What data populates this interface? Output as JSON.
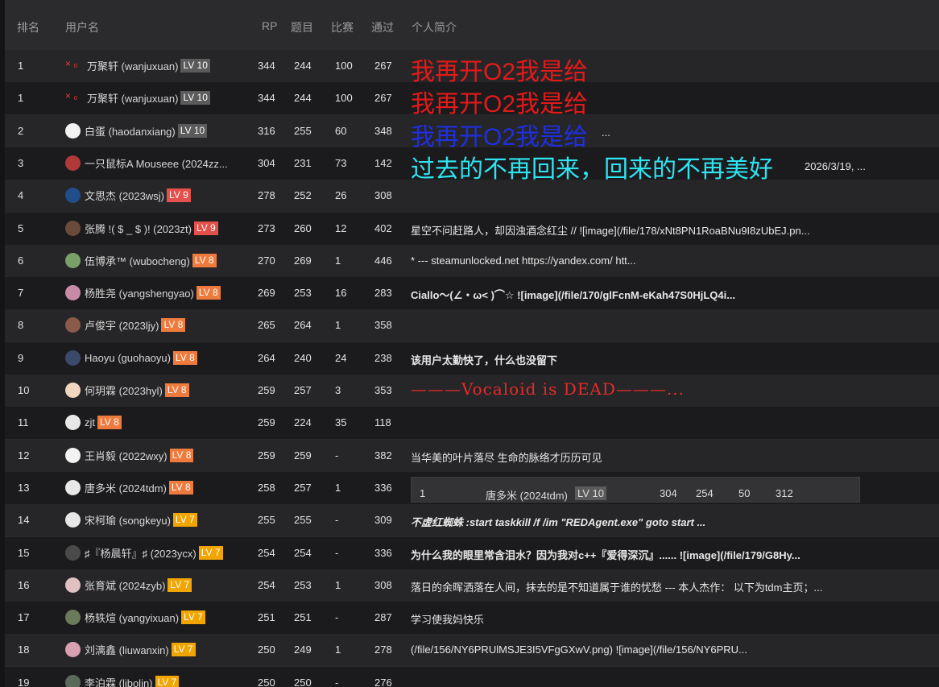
{
  "header": {
    "rank": "排名",
    "username": "用户名",
    "rp": "RP",
    "problems": "题目",
    "contests": "比赛",
    "passed": "通过",
    "intro": "个人简介"
  },
  "rows": [
    {
      "rank": "1",
      "name": "万聚轩 (wanjuxuan)",
      "lv": "LV 10",
      "rp": "344",
      "ti": "244",
      "bs": "100",
      "tg": "267",
      "intro": "我再开O2我是给",
      "intro_color": "#e4191a"
    },
    {
      "rank": "1",
      "name": "万聚轩 (wanjuxuan)",
      "lv": "LV 10",
      "rp": "344",
      "ti": "244",
      "bs": "100",
      "tg": "267",
      "intro": "我再开O2我是给",
      "intro_color": "#e4191a"
    },
    {
      "rank": "2",
      "name": "白蛋 (haodanxiang)",
      "lv": "LV 10",
      "rp": "316",
      "ti": "255",
      "bs": "60",
      "tg": "348",
      "intro": "我再开O2我是给",
      "intro_suffix": "...",
      "intro_color": "#1f2fe0"
    },
    {
      "rank": "3",
      "name": "一只鼠标A Mouseee (2024zz...",
      "lv": "",
      "rp": "304",
      "ti": "231",
      "bs": "73",
      "tg": "142",
      "intro": "过去的不再回来，回来的不再美好",
      "intro_suffix": "2026/3/19, ...",
      "intro_color": "#2fe3f0"
    },
    {
      "rank": "4",
      "name": "文思杰 (2023wsj)",
      "lv": "LV 9",
      "rp": "278",
      "ti": "252",
      "bs": "26",
      "tg": "308",
      "intro": ""
    },
    {
      "rank": "5",
      "name": "张腾 !( $ _ $ )! (2023zt)",
      "lv": "LV 9",
      "rp": "273",
      "ti": "260",
      "bs": "12",
      "tg": "402",
      "intro": "星空不问赶路人，却因浊酒念红尘 // ![image](/file/178/xNt8PN1RoaBNu9I8zUbEJ.pn..."
    },
    {
      "rank": "6",
      "name": "伍博承™ (wubocheng)",
      "lv": "LV 8",
      "rp": "270",
      "ti": "269",
      "bs": "1",
      "tg": "446",
      "intro": "* --- steamunlocked.net https://yandex.com/ htt..."
    },
    {
      "rank": "7",
      "name": "杨胜尧 (yangshengyao)",
      "lv": "LV 8",
      "rp": "269",
      "ti": "253",
      "bs": "16",
      "tg": "283",
      "intro": "Ciallo～(∠・ω< )⌒☆ ![image](/file/170/glFcnM-eKah47S0HjLQ4i..."
    },
    {
      "rank": "8",
      "name": "卢俊宇 (2023ljy)",
      "lv": "LV 8",
      "rp": "265",
      "ti": "264",
      "bs": "1",
      "tg": "358",
      "intro": ""
    },
    {
      "rank": "9",
      "name": "Haoyu (guohaoyu)",
      "lv": "LV 8",
      "rp": "264",
      "ti": "240",
      "bs": "24",
      "tg": "238",
      "intro": "该用户太勤快了，什么也没留下"
    },
    {
      "rank": "10",
      "name": "何玥霖 (2023hyl)",
      "lv": "LV 8",
      "rp": "259",
      "ti": "257",
      "bs": "3",
      "tg": "353",
      "intro": "———Vocaloid is DEAD———..."
    },
    {
      "rank": "11",
      "name": "zjt",
      "lv": "LV 8",
      "rp": "259",
      "ti": "224",
      "bs": "35",
      "tg": "118",
      "intro": ""
    },
    {
      "rank": "12",
      "name": "王肖毅 (2022wxy)",
      "lv": "LV 8",
      "rp": "259",
      "ti": "259",
      "bs": "-",
      "tg": "382",
      "intro": "当华美的叶片落尽 生命的脉络才历历可见"
    },
    {
      "rank": "13",
      "name": "唐多米 (2024tdm)",
      "lv": "LV 8",
      "rp": "258",
      "ti": "257",
      "bs": "1",
      "tg": "336",
      "intro": "",
      "nested": {
        "rank": "1",
        "name": "唐多米 (2024tdm)",
        "lv": "LV 10",
        "rp": "304",
        "ti": "254",
        "bs": "50",
        "tg": "312"
      }
    },
    {
      "rank": "14",
      "name": "宋柯瑜 (songkeyu)",
      "lv": "LV 7",
      "rp": "255",
      "ti": "255",
      "bs": "-",
      "tg": "309",
      "intro": "不虚红蜘蛛 :start taskkill /f /im \"REDAgent.exe\" goto start ..."
    },
    {
      "rank": "15",
      "name": "♯『杨晨轩』♯ (2023ycx)",
      "lv": "LV 7",
      "rp": "254",
      "ti": "254",
      "bs": "-",
      "tg": "336",
      "intro": "为什么我的眼里常含泪水？因为我对c++『爱得深沉』...... ![image](/file/179/G8Hy..."
    },
    {
      "rank": "16",
      "name": "张育斌 (2024zyb)",
      "lv": "LV 7",
      "rp": "254",
      "ti": "253",
      "bs": "1",
      "tg": "308",
      "intro": "落日的余晖洒落在人间，抹去的是不知道属于谁的忧愁 --- 本人杰作：  以下为tdm主页；..."
    },
    {
      "rank": "17",
      "name": "杨轶煊 (yangyixuan)",
      "lv": "LV 7",
      "rp": "251",
      "ti": "251",
      "bs": "-",
      "tg": "287",
      "intro": "学习使我妈快乐"
    },
    {
      "rank": "18",
      "name": "刘漓鑫 (liuwanxin)",
      "lv": "LV 7",
      "rp": "250",
      "ti": "249",
      "bs": "1",
      "tg": "278",
      "intro": "(/file/156/NY6PRUlMSJE3I5VFgGXwV.png) ![image](/file/156/NY6PRU..."
    },
    {
      "rank": "19",
      "name": "李泊霖 (libolin)",
      "lv": "LV 7",
      "rp": "250",
      "ti": "250",
      "bs": "-",
      "tg": "276",
      "intro": ""
    }
  ],
  "avatar_colors": [
    "#cc3a3a",
    "#cc3a3a",
    "#f2f2f2",
    "#b03a3a",
    "#1f4e8a",
    "#6a4b3a",
    "#7aa06a",
    "#c98aa8",
    "#8a5a4a",
    "#3a4a6a",
    "#f2d7c0",
    "#e8e8e8",
    "#f2f2f2",
    "#e8e8e8",
    "#e8e8e8",
    "#4a4a4a",
    "#e0c0c0",
    "#6a7a5a",
    "#d8a0b0",
    "#5a6a5a"
  ]
}
